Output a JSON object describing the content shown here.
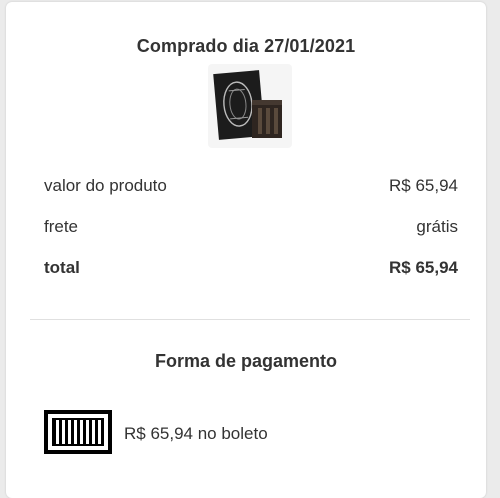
{
  "purchase": {
    "title": "Comprado dia 27/01/2021",
    "product_image_icon": "book-box-set-image"
  },
  "summary": {
    "rows": [
      {
        "label": "valor do produto",
        "value": "R$ 65,94"
      },
      {
        "label": "frete",
        "value": "grátis"
      },
      {
        "label": "total",
        "value": "R$ 65,94"
      }
    ]
  },
  "payment": {
    "title": "Forma de pagamento",
    "method_icon": "barcode-boleto-icon",
    "text": "R$ 65,94 no boleto"
  },
  "colors": {
    "text": "#333333",
    "background": "#ebebeb",
    "card": "#ffffff"
  }
}
